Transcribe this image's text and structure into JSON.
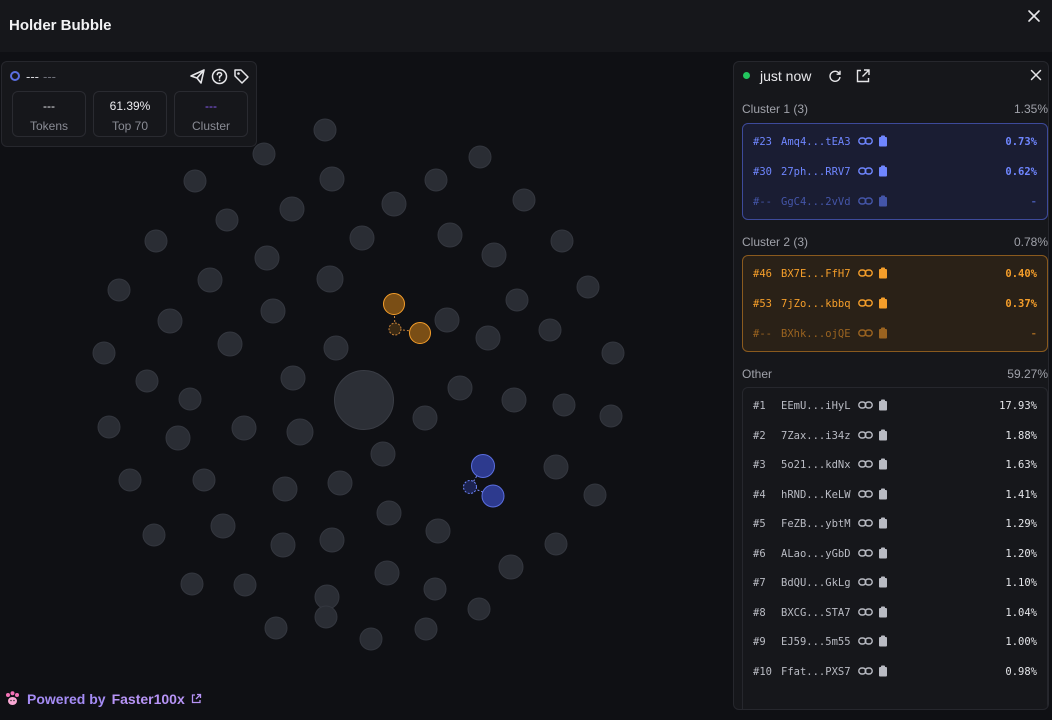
{
  "app": {
    "title": "Holder Bubble"
  },
  "info": {
    "label": "---",
    "label_dim": "---",
    "stats": [
      {
        "value": "---",
        "label": "Tokens"
      },
      {
        "value": "61.39%",
        "label": "Top 70"
      },
      {
        "value": "---",
        "label": "Cluster"
      }
    ]
  },
  "powered": {
    "prefix": "Powered by",
    "brand": "Faster100x"
  },
  "panel": {
    "status": "just now",
    "clusters": [
      {
        "name": "Cluster 1 (3)",
        "pct": "1.35%",
        "rows": [
          {
            "rank": "#23",
            "addr": "Amq4...tEA3",
            "pct": "0.73%"
          },
          {
            "rank": "#30",
            "addr": "27ph...RRV7",
            "pct": "0.62%"
          },
          {
            "rank": "#--",
            "addr": "GgC4...2vVd",
            "pct": "-"
          }
        ]
      },
      {
        "name": "Cluster 2 (3)",
        "pct": "0.78%",
        "rows": [
          {
            "rank": "#46",
            "addr": "BX7E...FfH7",
            "pct": "0.40%"
          },
          {
            "rank": "#53",
            "addr": "7jZo...kbbq",
            "pct": "0.37%"
          },
          {
            "rank": "#--",
            "addr": "BXhk...ojQE",
            "pct": "-"
          }
        ]
      }
    ],
    "others": {
      "name": "Other",
      "pct": "59.27%",
      "rows": [
        {
          "rank": "#1",
          "addr": "EEmU...iHyL",
          "pct": "17.93%"
        },
        {
          "rank": "#2",
          "addr": "7Zax...i34z",
          "pct": "1.88%"
        },
        {
          "rank": "#3",
          "addr": "5o21...kdNx",
          "pct": "1.63%"
        },
        {
          "rank": "#4",
          "addr": "hRND...KeLW",
          "pct": "1.41%"
        },
        {
          "rank": "#5",
          "addr": "FeZB...ybtM",
          "pct": "1.29%"
        },
        {
          "rank": "#6",
          "addr": "ALao...yGbD",
          "pct": "1.20%"
        },
        {
          "rank": "#7",
          "addr": "BdQU...GkLg",
          "pct": "1.10%"
        },
        {
          "rank": "#8",
          "addr": "BXCG...STA7",
          "pct": "1.04%"
        },
        {
          "rank": "#9",
          "addr": "EJ59...5m55",
          "pct": "1.00%"
        },
        {
          "rank": "#10",
          "addr": "Ffat...PXS7",
          "pct": "0.98%"
        }
      ]
    }
  },
  "colors": {
    "cluster1": "#5a6ee0",
    "cluster2": "#f59e2a",
    "bubble": "#2a2d34",
    "accent": "#8b5cf6",
    "live": "#22c55e"
  },
  "icons": [
    "close-icon",
    "send-icon",
    "help-icon",
    "tag-icon",
    "refresh-icon",
    "external-link-icon",
    "link-icon",
    "copy-icon",
    "paw-icon"
  ]
}
